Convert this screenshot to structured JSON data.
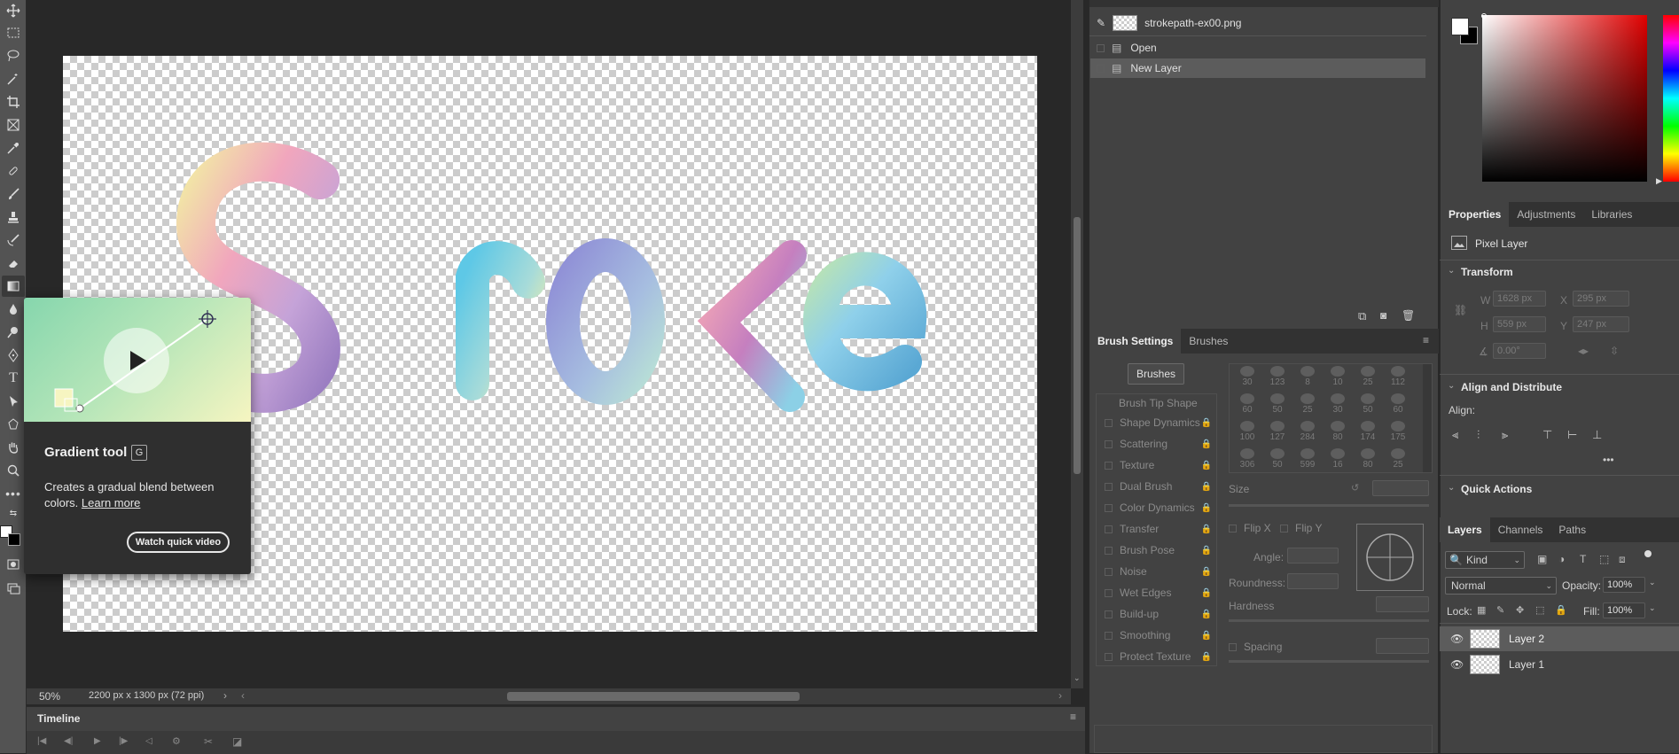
{
  "canvas": {
    "title_text": "Stroke"
  },
  "status": {
    "zoom": "50%",
    "doc_info": "2200 px x 1300 px (72 ppi)"
  },
  "timeline": {
    "title": "Timeline"
  },
  "tooltip": {
    "title": "Gradient tool",
    "shortcut": "G",
    "description": "Creates a gradual blend between colors.",
    "learn_more": "Learn more",
    "video_button": "Watch quick video"
  },
  "history": {
    "items": [
      {
        "label": "strokepath-ex00.png"
      },
      {
        "label": "Open"
      },
      {
        "label": "New Layer"
      }
    ]
  },
  "brush_panel": {
    "tabs": [
      "Brush Settings",
      "Brushes"
    ],
    "brushes_button": "Brushes",
    "tip_shape": "Brush Tip Shape",
    "options": [
      "Shape Dynamics",
      "Scattering",
      "Texture",
      "Dual Brush",
      "Color Dynamics",
      "Transfer",
      "Brush Pose",
      "Noise",
      "Wet Edges",
      "Build-up",
      "Smoothing",
      "Protect Texture"
    ],
    "preset_sizes": [
      "30",
      "123",
      "8",
      "10",
      "25",
      "112",
      "60",
      "50",
      "25",
      "30",
      "50",
      "60",
      "100",
      "127",
      "284",
      "80",
      "174",
      "175",
      "306",
      "50",
      "599",
      "16",
      "80",
      "25"
    ],
    "size_label": "Size",
    "flip_x": "Flip X",
    "flip_y": "Flip Y",
    "angle_label": "Angle:",
    "roundness_label": "Roundness:",
    "hardness_label": "Hardness",
    "spacing_label": "Spacing"
  },
  "properties": {
    "tabs": [
      "Properties",
      "Adjustments",
      "Libraries"
    ],
    "layer_type": "Pixel Layer",
    "transform_title": "Transform",
    "w_label": "W",
    "w_value": "1628 px",
    "x_label": "X",
    "x_value": "295 px",
    "h_label": "H",
    "h_value": "559 px",
    "y_label": "Y",
    "y_value": "247 px",
    "angle_value": "0.00°",
    "align_title": "Align and Distribute",
    "align_label": "Align:",
    "quick_actions": "Quick Actions"
  },
  "layers": {
    "tabs": [
      "Layers",
      "Channels",
      "Paths"
    ],
    "kind": "Kind",
    "blend_mode": "Normal",
    "opacity_label": "Opacity:",
    "opacity_value": "100%",
    "lock_label": "Lock:",
    "fill_label": "Fill:",
    "fill_value": "100%",
    "items": [
      {
        "name": "Layer 2"
      },
      {
        "name": "Layer 1"
      }
    ]
  },
  "colors": {
    "ui_dark": "#282828",
    "panel": "#424242",
    "selected_row": "#5c5c5c"
  }
}
